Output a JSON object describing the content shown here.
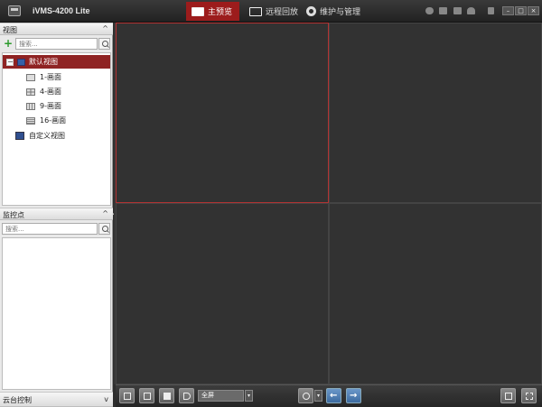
{
  "app": {
    "title": "iVMS-4200 Lite"
  },
  "main_tabs": [
    {
      "label": "主预览",
      "icon": "camera-icon"
    },
    {
      "label": "远程回放",
      "icon": "playback-icon"
    },
    {
      "label": "维护与管理",
      "icon": "gear-icon"
    }
  ],
  "window_controls": {
    "minimize": "–",
    "maximize": "□",
    "close": "×"
  },
  "view_panel": {
    "title": "视图",
    "collapse_glyph": "^",
    "search_placeholder": "搜索...",
    "add_glyph": "+",
    "tree": {
      "default_view": {
        "label": "默认视图",
        "expander": "−"
      },
      "layouts": [
        {
          "label": "1-画面"
        },
        {
          "label": "4-画面"
        },
        {
          "label": "9-画面"
        },
        {
          "label": "16-画面"
        }
      ],
      "custom_view": {
        "label": "自定义视图"
      }
    }
  },
  "monitor_panel": {
    "title": "监控点",
    "collapse_glyph": "^",
    "search_placeholder": "搜索..."
  },
  "ptz_panel": {
    "title": "云台控制",
    "collapse_glyph": "v"
  },
  "toolbar": {
    "screen_mode": "全屏",
    "dropdown_glyph": "▾",
    "prev_glyph": "←",
    "next_glyph": "→"
  },
  "colors": {
    "accent": "#9c1c1c",
    "active_pane_border": "#b33333"
  }
}
